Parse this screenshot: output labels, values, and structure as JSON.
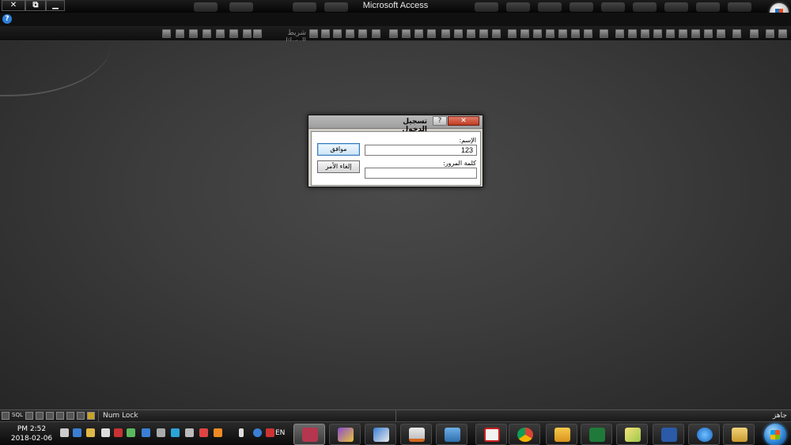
{
  "window": {
    "title": "Microsoft Access",
    "controls": {
      "close": "✕",
      "restore": "⧉",
      "minimize": "▁"
    }
  },
  "helpbar": {
    "help_icon": "help-icon"
  },
  "toolbar": {
    "label": "شريط الرسائل"
  },
  "dialog": {
    "title": "تسجيل الدخول",
    "help_glyph": "?",
    "close_glyph": "✕",
    "username_label": "الإسم:",
    "username_value": "123",
    "password_label": "كلمة المرور:",
    "password_value": "",
    "ok_label": "موافق",
    "cancel_label": "إلغاء الأمر"
  },
  "statusbar": {
    "left_text": "SQL",
    "numlock": "Num Lock",
    "ready": "جاهز"
  },
  "taskbar": {
    "time": "PM 2:52",
    "date": "2018-02-06",
    "language": "EN",
    "apps": [
      "access",
      "palette",
      "paint-brush",
      "java",
      "photo-viewer",
      "acrobat",
      "chrome",
      "outlook",
      "excel",
      "notepad",
      "word",
      "internet-explorer",
      "file-explorer"
    ]
  },
  "colors": {
    "workspace": "#3c3c3c",
    "dialog_bg": "#d4d0c8",
    "close_button": "#c03c21",
    "ok_border": "#3b7ab8"
  }
}
